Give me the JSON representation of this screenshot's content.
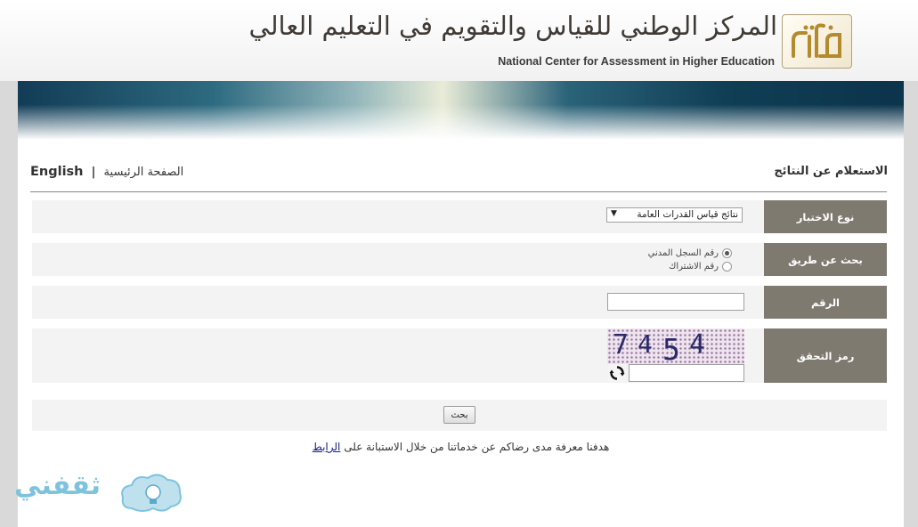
{
  "header": {
    "title_ar": "المركز الوطني للقياس والتقويم في التعليم العالي",
    "title_en": "National Center for Assessment in Higher Education",
    "logo_text": "قياس"
  },
  "page": {
    "title": "الاستعلام عن النتائج",
    "home_link": "الصفحة الرئيسية",
    "separator": "|",
    "lang_link": "English"
  },
  "form": {
    "exam_type": {
      "label": "نوع الاختبار",
      "selected": "نتائج قياس القدرات العامة",
      "arrow": "▼"
    },
    "search_by": {
      "label": "بحث عن طريق",
      "options": [
        {
          "label": "رقم السجل المدني",
          "checked": true
        },
        {
          "label": "رقم الاشتراك",
          "checked": false
        }
      ]
    },
    "number": {
      "label": "الرقم",
      "value": ""
    },
    "captcha": {
      "label": "رمز التحقق",
      "code": [
        "7",
        "4",
        "5",
        "4"
      ],
      "value": ""
    },
    "submit_label": "بحث"
  },
  "survey": {
    "text": "هدفنا معرفة مدى رضاكم عن خدماتنا من خلال الاستبانة على",
    "link": "الرابط"
  },
  "watermark": {
    "text": "ثقفني"
  },
  "colors": {
    "label_bg": "#7f7a70",
    "row_bg": "#f3f3f3",
    "watermark": "#7ec3dd"
  }
}
